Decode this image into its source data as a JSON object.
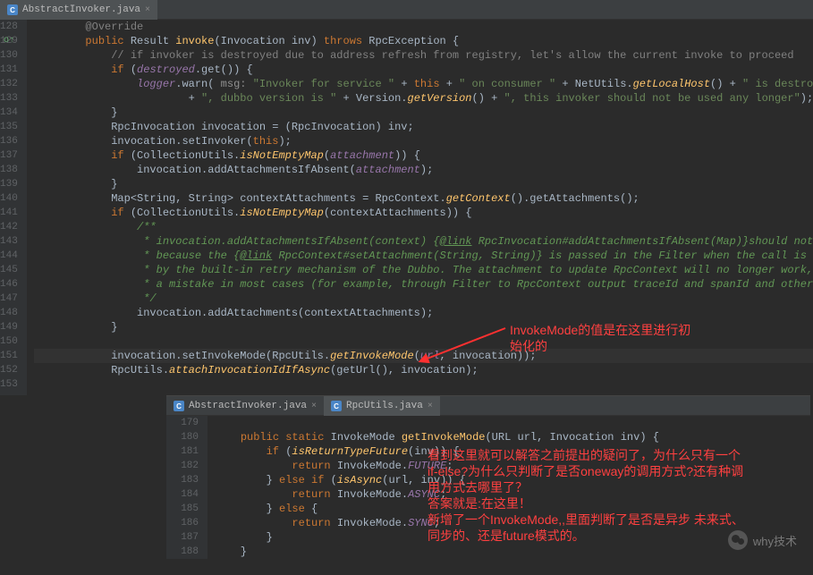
{
  "topTab": {
    "label": "AbstractInvoker.java"
  },
  "gutter1": {
    "start": 128,
    "end": 153
  },
  "code1": [
    {
      "i": 4,
      "frag": [
        [
          "",
          "        "
        ],
        [
          "cmt",
          "@Override"
        ]
      ]
    },
    {
      "i": 4,
      "frag": [
        [
          "",
          "        "
        ],
        [
          "kw",
          "public"
        ],
        [
          "",
          " Result "
        ],
        [
          "fn",
          "invoke"
        ],
        [
          "",
          "(Invocation inv) "
        ],
        [
          "kw",
          "throws"
        ],
        [
          "",
          " RpcException {"
        ]
      ]
    },
    {
      "i": 6,
      "frag": [
        [
          "",
          "            "
        ],
        [
          "cmt",
          "// if invoker is destroyed due to address refresh from registry, let's allow the current invoke to proceed"
        ]
      ]
    },
    {
      "i": 6,
      "frag": [
        [
          "",
          "            "
        ],
        [
          "kw",
          "if"
        ],
        [
          "",
          " ("
        ],
        [
          "field",
          "destroyed"
        ],
        [
          "",
          ".get()) {"
        ]
      ]
    },
    {
      "i": 8,
      "frag": [
        [
          "",
          "                "
        ],
        [
          "field",
          "logger"
        ],
        [
          "",
          ".warn( "
        ],
        [
          "param",
          "msg: "
        ],
        [
          "str",
          "\"Invoker for service \""
        ],
        [
          "",
          " + "
        ],
        [
          "this",
          "this"
        ],
        [
          "",
          " + "
        ],
        [
          "str",
          "\" on consumer \""
        ],
        [
          "",
          " + NetUtils."
        ],
        [
          "fni",
          "getLocalHost"
        ],
        [
          "",
          "() + "
        ],
        [
          "str",
          "\" is destroyed, \""
        ]
      ]
    },
    {
      "i": 10,
      "frag": [
        [
          "",
          "                        + "
        ],
        [
          "str",
          "\", dubbo version is \""
        ],
        [
          "",
          " + Version."
        ],
        [
          "fni",
          "getVersion"
        ],
        [
          "",
          "() + "
        ],
        [
          "str",
          "\", this invoker should not be used any longer\""
        ],
        [
          "",
          ");"
        ]
      ]
    },
    {
      "i": 6,
      "frag": [
        [
          "",
          "            }"
        ]
      ]
    },
    {
      "i": 6,
      "frag": [
        [
          "",
          "            RpcInvocation invocation = (RpcInvocation) inv;"
        ]
      ]
    },
    {
      "i": 6,
      "frag": [
        [
          "",
          "            invocation.setInvoker("
        ],
        [
          "this",
          "this"
        ],
        [
          "",
          ");"
        ]
      ]
    },
    {
      "i": 6,
      "frag": [
        [
          "",
          "            "
        ],
        [
          "kw",
          "if"
        ],
        [
          "",
          " (CollectionUtils."
        ],
        [
          "fni",
          "isNotEmptyMap"
        ],
        [
          "",
          "("
        ],
        [
          "field",
          "attachment"
        ],
        [
          "",
          ")) {"
        ]
      ]
    },
    {
      "i": 8,
      "frag": [
        [
          "",
          "                invocation.addAttachmentsIfAbsent("
        ],
        [
          "field",
          "attachment"
        ],
        [
          "",
          ");"
        ]
      ]
    },
    {
      "i": 6,
      "frag": [
        [
          "",
          "            }"
        ]
      ]
    },
    {
      "i": 6,
      "frag": [
        [
          "",
          "            Map<String, String> contextAttachments = RpcContext."
        ],
        [
          "fni",
          "getContext"
        ],
        [
          "",
          "().getAttachments();"
        ]
      ]
    },
    {
      "i": 6,
      "frag": [
        [
          "",
          "            "
        ],
        [
          "kw",
          "if"
        ],
        [
          "",
          " (CollectionUtils."
        ],
        [
          "fni",
          "isNotEmptyMap"
        ],
        [
          "",
          "(contextAttachments)) {"
        ]
      ]
    },
    {
      "i": 8,
      "frag": [
        [
          "",
          "                "
        ],
        [
          "doc",
          "/**"
        ]
      ]
    },
    {
      "i": 8,
      "frag": [
        [
          "",
          "                "
        ],
        [
          "doc",
          " * invocation.addAttachmentsIfAbsent(context) {"
        ],
        [
          "doctag",
          "@link"
        ],
        [
          "doc",
          " RpcInvocation#addAttachmentsIfAbsent(Map)}should not be used here,"
        ]
      ]
    },
    {
      "i": 8,
      "frag": [
        [
          "",
          "                "
        ],
        [
          "doc",
          " * because the {"
        ],
        [
          "doctag",
          "@link"
        ],
        [
          "doc",
          " RpcContext#setAttachment(String, String)} is passed in the Filter when the call is triggered"
        ]
      ]
    },
    {
      "i": 8,
      "frag": [
        [
          "",
          "                "
        ],
        [
          "doc",
          " * by the built-in retry mechanism of the Dubbo. The attachment to update RpcContext will no longer work, which is"
        ]
      ]
    },
    {
      "i": 8,
      "frag": [
        [
          "",
          "                "
        ],
        [
          "doc",
          " * a mistake in most cases (for example, through Filter to RpcContext output traceId and spanId and other information)."
        ]
      ]
    },
    {
      "i": 8,
      "frag": [
        [
          "",
          "                "
        ],
        [
          "doc",
          " */"
        ]
      ]
    },
    {
      "i": 8,
      "frag": [
        [
          "",
          "                invocation.addAttachments(contextAttachments);"
        ]
      ]
    },
    {
      "i": 6,
      "frag": [
        [
          "",
          "            }"
        ]
      ]
    },
    {
      "i": 6,
      "frag": [
        [
          "",
          ""
        ]
      ]
    },
    {
      "i": 6,
      "hl": true,
      "frag": [
        [
          "",
          "            invocation.setInvokeMode(RpcUtils."
        ],
        [
          "fni",
          "getInvokeMode"
        ],
        [
          "",
          "("
        ],
        [
          "field",
          "url"
        ],
        [
          "",
          ", invocation));"
        ]
      ]
    },
    {
      "i": 6,
      "frag": [
        [
          "",
          "            RpcUtils."
        ],
        [
          "fni",
          "attachInvocationIdIfAsync"
        ],
        [
          "",
          "(getUrl(), invocation);"
        ]
      ]
    },
    {
      "i": 6,
      "frag": [
        [
          "",
          ""
        ]
      ]
    }
  ],
  "note1": "InvokeMode的值是在这里进行初\n始化的",
  "insetTabs": [
    {
      "label": "AbstractInvoker.java",
      "active": false
    },
    {
      "label": "RpcUtils.java",
      "active": true
    }
  ],
  "gutter2": {
    "start": 179,
    "end": 188
  },
  "code2": [
    {
      "frag": [
        [
          "",
          ""
        ]
      ]
    },
    {
      "frag": [
        [
          "",
          "    "
        ],
        [
          "kw",
          "public static"
        ],
        [
          "",
          " InvokeMode "
        ],
        [
          "fn",
          "getInvokeMode"
        ],
        [
          "",
          "(URL url, Invocation inv) {"
        ]
      ]
    },
    {
      "frag": [
        [
          "",
          "        "
        ],
        [
          "kw",
          "if"
        ],
        [
          "",
          " ("
        ],
        [
          "fni",
          "isReturnTypeFuture"
        ],
        [
          "",
          "(inv)) {"
        ]
      ]
    },
    {
      "frag": [
        [
          "",
          "            "
        ],
        [
          "kw",
          "return"
        ],
        [
          "",
          " InvokeMode."
        ],
        [
          "field",
          "FUTURE"
        ],
        [
          "",
          ";"
        ]
      ]
    },
    {
      "frag": [
        [
          "",
          "        } "
        ],
        [
          "kw",
          "else if"
        ],
        [
          "",
          " ("
        ],
        [
          "fni",
          "isAsync"
        ],
        [
          "",
          "(url, inv)) {"
        ]
      ]
    },
    {
      "frag": [
        [
          "",
          "            "
        ],
        [
          "kw",
          "return"
        ],
        [
          "",
          " InvokeMode."
        ],
        [
          "field",
          "ASYNC"
        ],
        [
          "",
          ";"
        ]
      ]
    },
    {
      "frag": [
        [
          "",
          "        } "
        ],
        [
          "kw",
          "else"
        ],
        [
          "",
          " {"
        ]
      ]
    },
    {
      "frag": [
        [
          "",
          "            "
        ],
        [
          "kw",
          "return"
        ],
        [
          "",
          " InvokeMode."
        ],
        [
          "field",
          "SYNC"
        ],
        [
          "",
          ";"
        ]
      ]
    },
    {
      "frag": [
        [
          "",
          "        }"
        ]
      ]
    },
    {
      "frag": [
        [
          "",
          "    }"
        ]
      ]
    }
  ],
  "note2": "看到这里就可以解答之前提出的疑问了，为什么只有一个\nif-else?为什么只判断了是否oneway的调用方式?还有种调\n用方式去哪里了？\n答案就是:在这里！\n新增了一个InvokeMode,,里面判断了是否是异步  未来式、\n同步的、还是future模式的。",
  "watermark": "why技术"
}
